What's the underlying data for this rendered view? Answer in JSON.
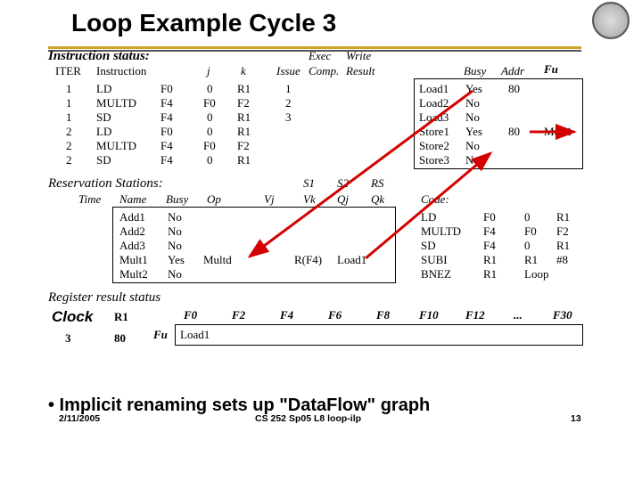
{
  "title": "Loop Example Cycle 3",
  "sections": {
    "instr": "Instruction status:",
    "rs": "Reservation Stations:",
    "rrs": "Register result status"
  },
  "instr_hdr": {
    "iter": "ITER",
    "instr": "Instruction",
    "j": "j",
    "k": "k",
    "issue": "Issue",
    "exec": "Exec",
    "comp": "Comp.",
    "write": "Write",
    "result": "Result",
    "busy": "Busy",
    "addr": "Addr",
    "fu": "Fu"
  },
  "instr_rows": [
    {
      "iter": "1",
      "op": "LD",
      "dst": "F0",
      "j": "0",
      "k": "R1",
      "issue": "1"
    },
    {
      "iter": "1",
      "op": "MULTD",
      "dst": "F4",
      "j": "F0",
      "k": "F2",
      "issue": "2"
    },
    {
      "iter": "1",
      "op": "SD",
      "dst": "F4",
      "j": "0",
      "k": "R1",
      "issue": "3"
    },
    {
      "iter": "2",
      "op": "LD",
      "dst": "F0",
      "j": "0",
      "k": "R1",
      "issue": ""
    },
    {
      "iter": "2",
      "op": "MULTD",
      "dst": "F4",
      "j": "F0",
      "k": "F2",
      "issue": ""
    },
    {
      "iter": "2",
      "op": "SD",
      "dst": "F4",
      "j": "0",
      "k": "R1",
      "issue": ""
    }
  ],
  "fu_rows": [
    {
      "name": "Load1",
      "busy": "Yes",
      "addr": "80",
      "fu": ""
    },
    {
      "name": "Load2",
      "busy": "No",
      "addr": "",
      "fu": ""
    },
    {
      "name": "Load3",
      "busy": "No",
      "addr": "",
      "fu": ""
    },
    {
      "name": "Store1",
      "busy": "Yes",
      "addr": "80",
      "fu": "Mult1"
    },
    {
      "name": "Store2",
      "busy": "No",
      "addr": "",
      "fu": ""
    },
    {
      "name": "Store3",
      "busy": "No",
      "addr": "",
      "fu": ""
    }
  ],
  "rs_hdr": {
    "time": "Time",
    "name": "Name",
    "busy": "Busy",
    "op": "Op",
    "vj": "Vj",
    "s1": "S1",
    "vk": "Vk",
    "s2": "S2",
    "qj": "Qj",
    "rs": "RS",
    "qk": "Qk",
    "code": "Code:"
  },
  "rs_rows": [
    {
      "name": "Add1",
      "busy": "No",
      "op": "",
      "vj": "",
      "vk": "",
      "qj": "",
      "qk": ""
    },
    {
      "name": "Add2",
      "busy": "No",
      "op": "",
      "vj": "",
      "vk": "",
      "qj": "",
      "qk": ""
    },
    {
      "name": "Add3",
      "busy": "No",
      "op": "",
      "vj": "",
      "vk": "",
      "qj": "",
      "qk": ""
    },
    {
      "name": "Mult1",
      "busy": "Yes",
      "op": "Multd",
      "vj": "",
      "vk": "R(F4)",
      "qj": "Load1",
      "qk": ""
    },
    {
      "name": "Mult2",
      "busy": "No",
      "op": "",
      "vj": "",
      "vk": "",
      "qj": "",
      "qk": ""
    }
  ],
  "code_rows": [
    {
      "op": "LD",
      "a": "F0",
      "b": "0",
      "c": "R1"
    },
    {
      "op": "MULTD",
      "a": "F4",
      "b": "F0",
      "c": "F2"
    },
    {
      "op": "SD",
      "a": "F4",
      "b": "0",
      "c": "R1"
    },
    {
      "op": "SUBI",
      "a": "R1",
      "b": "R1",
      "c": "#8"
    },
    {
      "op": "BNEZ",
      "a": "R1",
      "b": "Loop",
      "c": ""
    }
  ],
  "reg_hdr": [
    "R1",
    "F0",
    "F2",
    "F4",
    "F6",
    "F8",
    "F10",
    "F12",
    "...",
    "F30"
  ],
  "reg_row": {
    "fu_label": "Fu",
    "r1": "80",
    "f0": "Load1"
  },
  "clock_label": "Clock",
  "clock_val": "3",
  "bullet": "• Implicit renaming sets up \"DataFlow\" graph",
  "footer_date": "2/11/2005",
  "footer_center": "CS 252 Sp05 L8 loop-ilp",
  "slide_num": "13"
}
